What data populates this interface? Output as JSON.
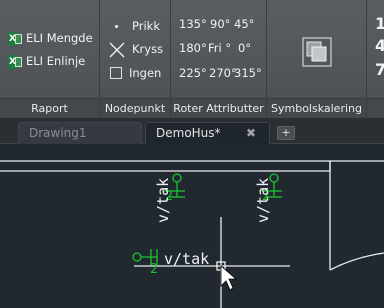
{
  "ribbon": {
    "rapport": {
      "title": "Raport",
      "items": [
        {
          "label": "ELI Mengde",
          "icon": "excel-icon"
        },
        {
          "label": "ELI Enlinje",
          "icon": "excel-icon"
        }
      ]
    },
    "nodepunkt": {
      "title": "Nodepunkt",
      "items": [
        {
          "label": "Prikk",
          "icon": "dot-icon"
        },
        {
          "label": "Kryss",
          "icon": "cross-icon"
        },
        {
          "label": "Ingen",
          "icon": "empty-box-icon"
        }
      ]
    },
    "roter": {
      "title": "Roter Attributter",
      "rows": [
        [
          "135°",
          "90°",
          "45°"
        ],
        [
          "180°",
          "Fri °",
          "0°"
        ],
        [
          "225°",
          "270°",
          "315°"
        ]
      ]
    },
    "symbolskalering": {
      "title": "Symbolskalering",
      "icon": "scale-icon"
    },
    "overflow_chars": [
      "1",
      "4",
      "7"
    ]
  },
  "tabs": [
    {
      "label": "Drawing1",
      "active": false
    },
    {
      "label": "DemoHus*",
      "active": true
    }
  ],
  "newtab_label": "+",
  "tab_close_glyph": "✖",
  "drawing": {
    "labels": [
      "v/tak",
      "v/tak",
      "v/tak"
    ],
    "symbol_numbers": [
      "2",
      "2",
      "2"
    ],
    "colors": {
      "symbol": "#18c42c",
      "lines": "#e9eef2",
      "background": "#212830"
    }
  }
}
